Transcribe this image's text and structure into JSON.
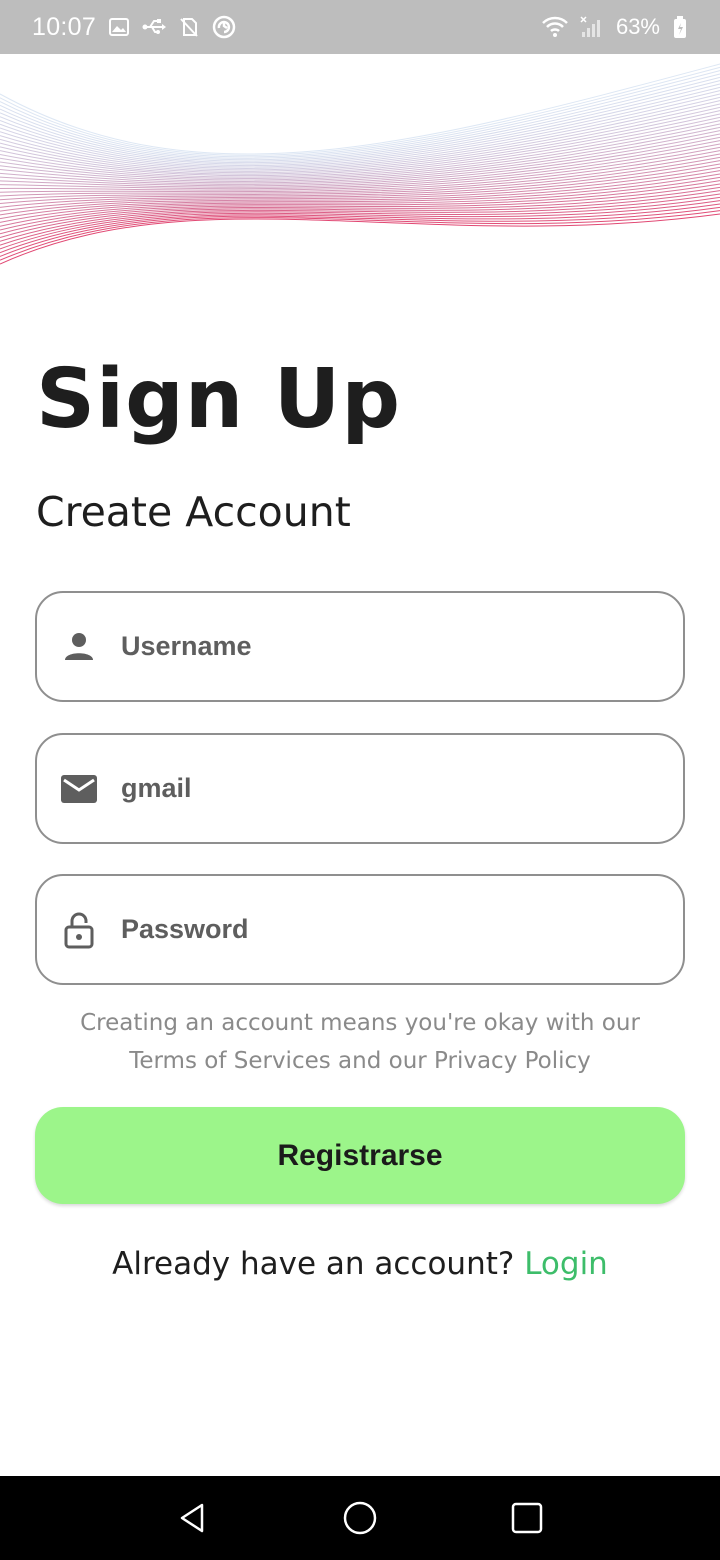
{
  "status_bar": {
    "time": "10:07",
    "battery": "63%",
    "icons": [
      "image-icon",
      "usb-icon",
      "sim-off-icon",
      "sync-icon",
      "wifi-icon",
      "signal-icon",
      "battery-icon"
    ]
  },
  "page": {
    "title": "Sign Up",
    "subtitle": "Create Account"
  },
  "form": {
    "username": {
      "placeholder": "Username",
      "icon": "person-icon"
    },
    "email": {
      "placeholder": "gmail",
      "icon": "mail-icon"
    },
    "password": {
      "placeholder": "Password",
      "icon": "lock-icon"
    }
  },
  "terms": {
    "line1": "Creating an account means you're okay with our",
    "line2": "Terms of Services and our Privacy Policy"
  },
  "register_button": {
    "label": "Registrarse",
    "color": "#9cf58a"
  },
  "login_prompt": {
    "text": "Already have an account? ",
    "link": "Login",
    "link_color": "#3dbd6a"
  },
  "nav_bar": {
    "icons": [
      "back-icon",
      "home-icon",
      "recents-icon"
    ]
  }
}
